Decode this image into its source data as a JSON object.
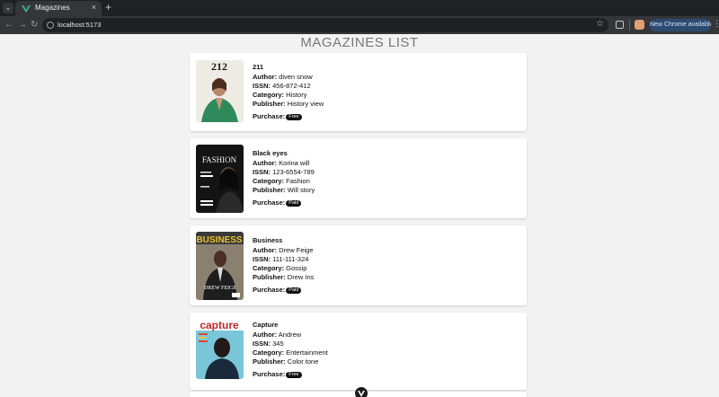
{
  "browser": {
    "tab_title": "Magazines",
    "tab_close": "×",
    "new_tab": "+",
    "url": "localhost:5173",
    "chrome_button": "New Chrome available"
  },
  "page": {
    "title": "MAGAZINES LIST"
  },
  "labels": {
    "author": "Author:",
    "issn": "ISSN:",
    "category": "Category:",
    "publisher": "Publisher:",
    "purchase": "Purchase:"
  },
  "magazines": [
    {
      "title": "211",
      "author": "diven snow",
      "issn": "456-872-412",
      "category": "History",
      "publisher": "History view",
      "purchase": "Free",
      "cover_text": "212"
    },
    {
      "title": "Black eyes",
      "author": "Korina will",
      "issn": "123-6554-789",
      "category": "Fashion",
      "publisher": "Will story",
      "purchase": "Paid",
      "cover_text": "FASHION"
    },
    {
      "title": "Business",
      "author": "Drew Feige",
      "issn": "111-111-324",
      "category": "Gossip",
      "publisher": "Drew Ins",
      "purchase": "Paid",
      "cover_text": "BUSINESS"
    },
    {
      "title": "Capture",
      "author": "Andrew",
      "issn": "345",
      "category": "Entertainment",
      "publisher": "Color tone",
      "purchase": "Free",
      "cover_text": "capture"
    }
  ],
  "colors": {
    "accent_vue": "#41b883",
    "badge_bg": "#111111"
  },
  "icons": {
    "tab_search": "chevron-down-icon",
    "back": "arrow-left-icon",
    "forward": "arrow-right-icon",
    "reload": "reload-icon",
    "fab": "vuejs-icon"
  }
}
